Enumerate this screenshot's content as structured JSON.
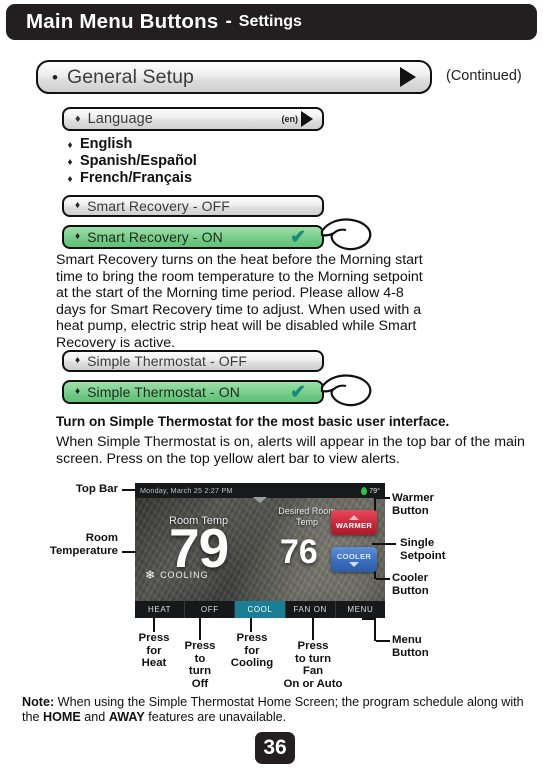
{
  "header": {
    "title": "Main Menu Buttons",
    "separator": "-",
    "subtitle": "Settings"
  },
  "general_setup": {
    "bullet": "•",
    "label": "General Setup",
    "arrow_icon": "play-triangle-icon",
    "continued": "(Continued)"
  },
  "language": {
    "bullet": "♦",
    "label": "Language",
    "code": "(en)",
    "arrow_icon": "play-triangle-icon",
    "options": [
      {
        "bullet": "♦",
        "label": "English"
      },
      {
        "bullet": "♦",
        "label": "Spanish/Español"
      },
      {
        "bullet": "♦",
        "label": "French/Français"
      }
    ]
  },
  "smart_recovery": {
    "off_bullet": "♦",
    "off_label": "Smart Recovery - OFF",
    "on_bullet": "♦",
    "on_label": "Smart Recovery - ON",
    "check_icon": "✔",
    "description": "Smart Recovery turns on the heat before the Morning start time to bring the room temperature to the Morning setpoint at the start of the Morning time period. Please allow 4-8 days for Smart Recovery time to adjust.  When used with a heat pump, electric strip heat will be disabled while Smart Recovery is active."
  },
  "simple_thermostat": {
    "off_bullet": "♦",
    "off_label": "Simple Thermostat - OFF",
    "on_bullet": "♦",
    "on_label": "Simple Thermostat - ON",
    "check_icon": "✔",
    "bold_line": "Turn on Simple Thermostat for the most basic user interface.",
    "description": "When Simple Thermostat is on, alerts will appear in the top bar of the main screen.  Press on the top yellow alert bar to view alerts."
  },
  "thermostat_screen": {
    "datetime": "Monday, March 25  2:27 PM",
    "outdoor_icon": "leaf-icon",
    "outdoor_temp": "79°",
    "chevron_icon": "chevron-down-icon",
    "room_temp_label": "Room Temp",
    "room_temp_value": "79",
    "desired_label": "Desired Room Temp",
    "setpoint_value": "76",
    "status_icon": "❄",
    "status_text": "COOLING",
    "warmer_button": {
      "label": "WARMER",
      "arrow_icon": "arrow-up-icon",
      "color": "#c9263a"
    },
    "cooler_button": {
      "label": "COOLER",
      "arrow_icon": "arrow-down-icon",
      "color": "#3a6ec0"
    },
    "bottom_buttons": [
      {
        "label": "HEAT",
        "active": false
      },
      {
        "label": "OFF",
        "active": false
      },
      {
        "label": "COOL",
        "active": true
      },
      {
        "label": "FAN ON",
        "active": false
      },
      {
        "label": "MENU",
        "active": false
      }
    ],
    "active_color": "#1a7e96"
  },
  "callouts": {
    "top_bar": "Top Bar",
    "room_temperature": "Room\nTemperature",
    "warmer_button": "Warmer\nButton",
    "single_setpoint": "Single\nSetpoint",
    "cooler_button": "Cooler\nButton",
    "menu_button": "Menu\nButton",
    "press_heat": "Press\nfor\nHeat",
    "press_off": "Press\nto\nturn\nOff",
    "press_cool": "Press\nfor\nCooling",
    "press_fan": "Press\nto turn\nFan\nOn or Auto"
  },
  "note": {
    "label": "Note:",
    "text_1": " When using the Simple Thermostat Home Screen; the program schedule along with the ",
    "home": "HOME",
    "text_2": " and ",
    "away": "AWAY",
    "text_3": " features are unavailable."
  },
  "page_number": "36",
  "colors": {
    "header_bg": "#231f20",
    "green_selected": "#7fd08f",
    "check_green": "#178a7a"
  }
}
